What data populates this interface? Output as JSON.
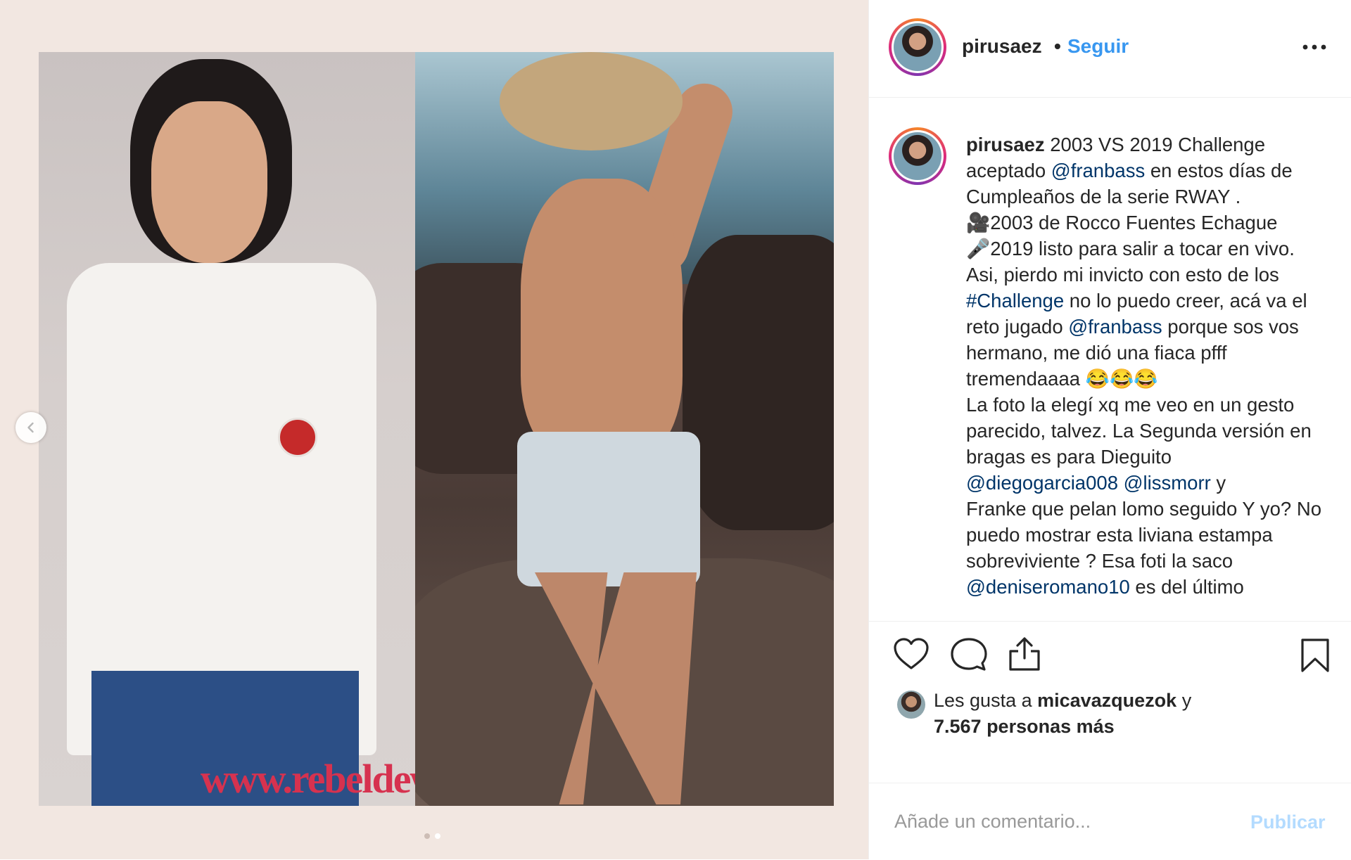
{
  "post": {
    "username": "pirusaez",
    "separator": "•",
    "follow_label": "Seguir",
    "more_label": "•••"
  },
  "media": {
    "watermark": "www.rebeldeway.c",
    "slide_index": 2,
    "slide_count": 2
  },
  "caption": {
    "username": "pirusaez",
    "segments": [
      {
        "text": " 2003 VS 2019 Challenge aceptado ",
        "link": false
      },
      {
        "text": "@franbass",
        "link": true
      },
      {
        "text": " en estos días de Cumpleaños de la serie RWAY .",
        "link": false
      },
      {
        "text": "\n🎥2003 de Rocco Fuentes Echague\n🎤2019 listo para salir a tocar en vivo.\nAsi, pierdo mi invicto con esto de los ",
        "link": false
      },
      {
        "text": "#Challenge",
        "link": true
      },
      {
        "text": " no lo puedo creer, acá va el reto jugado ",
        "link": false
      },
      {
        "text": "@franbass",
        "link": true
      },
      {
        "text": " porque sos vos hermano, me dió una fiaca pfff tremendaaaa 😂😂😂\nLa foto la elegí xq me veo en un gesto parecido, talvez. La Segunda versión en bragas es para Dieguito\n",
        "link": false
      },
      {
        "text": "@diegogarcia008",
        "link": true
      },
      {
        "text": " ",
        "link": false
      },
      {
        "text": "@lissmorr",
        "link": true
      },
      {
        "text": " y\nFranke que pelan lomo seguido Y yo? No puedo mostrar esta liviana estampa sobreviviente ? Esa foti la saco ",
        "link": false
      },
      {
        "text": "@deniseromano10",
        "link": true
      },
      {
        "text": " es del último",
        "link": false
      }
    ]
  },
  "likes": {
    "prefix": "Les gusta a ",
    "user": "micavazquezok",
    "middle": " y",
    "count_text": "7.567 personas más"
  },
  "comment": {
    "placeholder": "Añade un comentario...",
    "publish_label": "Publicar"
  },
  "colors": {
    "link": "#003569",
    "follow": "#3897f0",
    "publish_disabled": "#b3dbff"
  },
  "icons": [
    "chevron-left-icon",
    "heart-icon",
    "comment-icon",
    "share-icon",
    "bookmark-icon",
    "more-icon"
  ]
}
